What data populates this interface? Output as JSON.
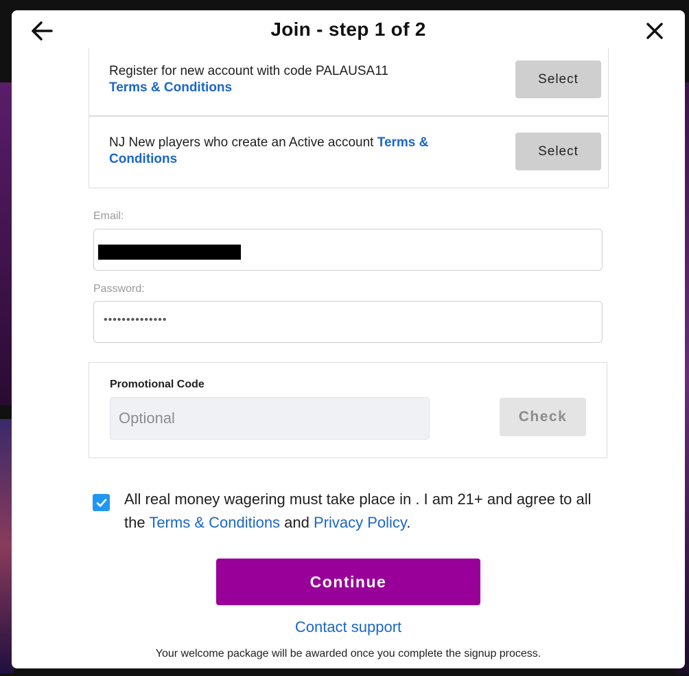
{
  "header": {
    "title": "Join - step 1 of 2",
    "back_icon": "arrow-left-icon",
    "close_icon": "close-icon"
  },
  "offers": [
    {
      "text": "Register for new account with code PALAUSA11",
      "link": "Terms & Conditions",
      "button": "Select"
    },
    {
      "text": "NJ New players who create an Active account ",
      "link": "Terms & Conditions",
      "button": "Select"
    }
  ],
  "email": {
    "label": "Email:",
    "value_redacted": true
  },
  "password": {
    "label": "Password:",
    "value": "••••••••••••••"
  },
  "promo": {
    "title": "Promotional Code",
    "placeholder": "Optional",
    "button": "Check"
  },
  "agreement": {
    "checked": true,
    "text_start": "All real money wagering must take place in . I am 21+ and agree to all the ",
    "terms_link": "Terms & Conditions",
    "middle": " and ",
    "privacy_link": "Privacy Policy",
    "end": "."
  },
  "actions": {
    "continue": "Continue",
    "support": "Contact support",
    "footer_note": "Your welcome package will be awarded once you complete the signup process."
  },
  "colors": {
    "accent": "#990099",
    "link": "#1a66c8",
    "checkbox": "#2196f3"
  }
}
